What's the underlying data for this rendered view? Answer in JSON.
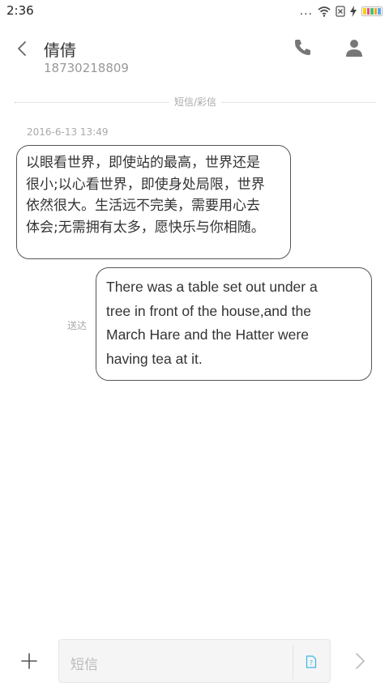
{
  "status_bar": {
    "time": "2:36",
    "signal_dots": "...",
    "battery_colors": [
      "#f5d20a",
      "#e94b8a",
      "#4dc16a",
      "#f5a623",
      "#5aa9f0"
    ]
  },
  "header": {
    "contact_name": "倩倩",
    "contact_number": "18730218809"
  },
  "conversation": {
    "type_label": "短信/彩信",
    "timestamp": "2016-6-13 13:49",
    "incoming": {
      "lines": [
        "以眼看世界，即使站的最高，世界还是",
        "很小;以心看世界，即使身处局限，世界",
        "依然很大。生活远不完美，需要用心去",
        "体会;无需拥有太多，愿快乐与你相随。"
      ]
    },
    "outgoing": {
      "lines": [
        "There was a table set out under a",
        "tree in front of the house,and the",
        "March Hare and the Hatter were",
        "having tea at it."
      ],
      "status": "送达"
    }
  },
  "composer": {
    "placeholder": "短信",
    "accent_color": "#3cb6e3"
  }
}
